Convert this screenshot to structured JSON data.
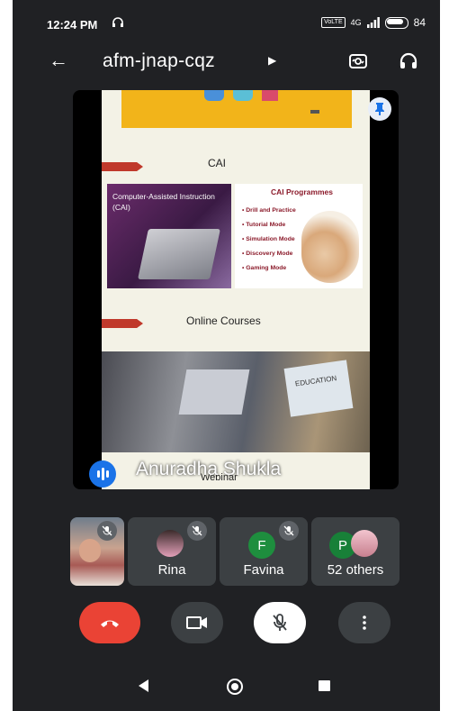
{
  "status_bar": {
    "time": "12:24 PM",
    "volte_badge": "VoLTE",
    "network": "4G",
    "battery": "84"
  },
  "header": {
    "meeting_code": "afm-jnap-cqz"
  },
  "presentation": {
    "sections": [
      "CAI",
      "Online Courses",
      "Webinar"
    ],
    "cai_image_title": "Computer-Assisted Instruction (CAI)",
    "cai_list_title": "CAI Programmes",
    "cai_items": [
      "• Drill and Practice",
      "• Tutorial Mode",
      "• Simulation Mode",
      "• Discovery Mode",
      "• Gaming Mode"
    ],
    "online_screen_text": "EDUCATION",
    "speaker_name": "Anuradha Shukla"
  },
  "participants": [
    {
      "name": "",
      "muted": true
    },
    {
      "name": "Rina",
      "muted": true
    },
    {
      "name": "Favina",
      "initial": "F",
      "muted": true
    },
    {
      "name": "52 others",
      "initial": "P"
    }
  ],
  "colors": {
    "background": "#202124",
    "tile": "#3c4043",
    "end_call": "#ea4335",
    "speaker_accent": "#1a73e8",
    "favina_avatar": "#1e8e3e",
    "others_avatar": "#188038"
  }
}
